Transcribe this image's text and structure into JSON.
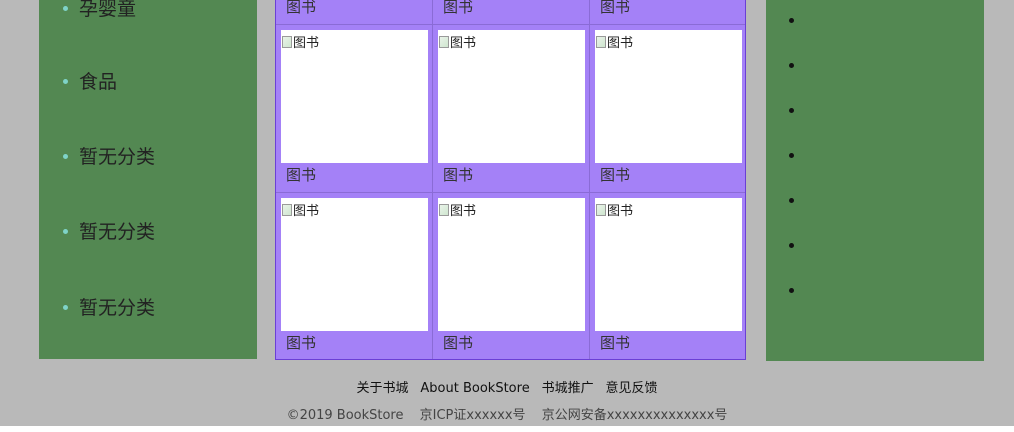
{
  "sidebar": {
    "categories": [
      {
        "label": "孕婴童"
      },
      {
        "label": "食品"
      },
      {
        "label": "暂无分类"
      },
      {
        "label": "暂无分类"
      },
      {
        "label": "暂无分类"
      }
    ]
  },
  "grid": {
    "top_captions": [
      "图书",
      "图书",
      "图书"
    ],
    "rows": [
      {
        "items": [
          {
            "alt": "图书",
            "caption": "图书"
          },
          {
            "alt": "图书",
            "caption": "图书"
          },
          {
            "alt": "图书",
            "caption": "图书"
          }
        ]
      },
      {
        "items": [
          {
            "alt": "图书",
            "caption": "图书"
          },
          {
            "alt": "图书",
            "caption": "图书"
          },
          {
            "alt": "图书",
            "caption": "图书"
          }
        ]
      }
    ]
  },
  "footer": {
    "links": [
      "关于书城",
      "About BookStore",
      "书城推广",
      "意见反馈"
    ],
    "copyright": "©2019 BookStore",
    "icp": "京ICP证xxxxxx号",
    "security": "京公网安备xxxxxxxxxxxxxx号"
  },
  "colors": {
    "sidebar_bg": "#538852",
    "grid_bg": "#a481f7",
    "page_bg": "#b9b9b9"
  }
}
